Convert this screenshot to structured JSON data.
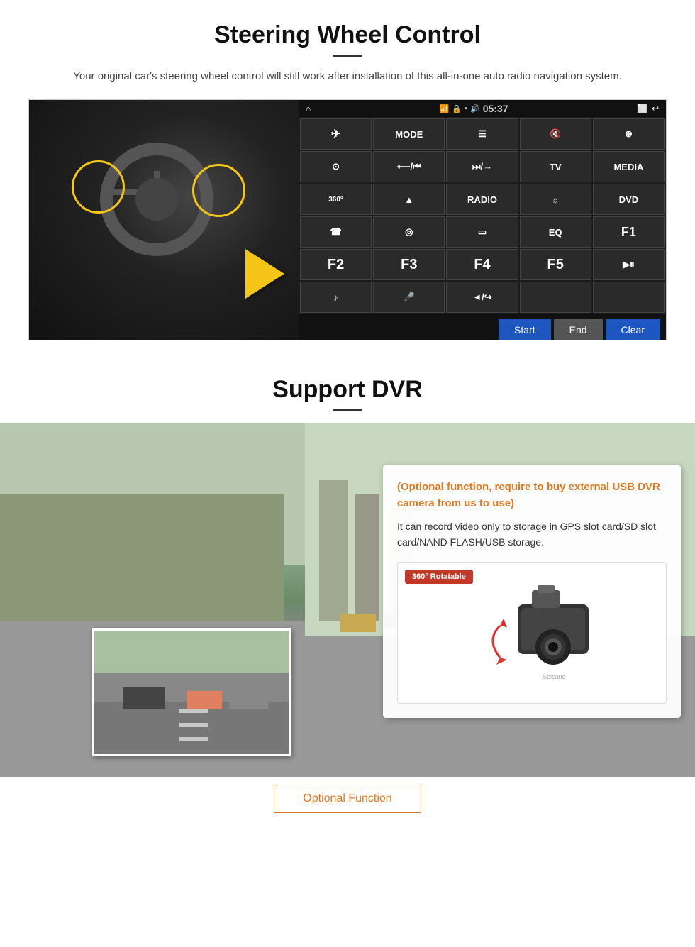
{
  "steering": {
    "title": "Steering Wheel Control",
    "subtitle": "Your original car's steering wheel control will still work after installation of this all-in-one auto radio navigation system.",
    "status_bar": {
      "home_icon": "⌂",
      "wifi_icon": "WiFi",
      "lock_icon": "🔒",
      "battery_icon": "▪",
      "volume_icon": "🔊",
      "time": "05:37",
      "window_icon": "⬜",
      "back_icon": "↩"
    },
    "buttons": [
      {
        "label": "✈",
        "icon": "navigation-icon"
      },
      {
        "label": "MODE",
        "icon": "mode-icon"
      },
      {
        "label": "≡",
        "icon": "menu-icon"
      },
      {
        "label": "🔇",
        "icon": "mute-icon"
      },
      {
        "label": "⊕",
        "icon": "apps-icon"
      },
      {
        "label": "⊙",
        "icon": "settings-icon"
      },
      {
        "label": "⟵/⏮",
        "icon": "rewind-icon"
      },
      {
        "label": "⏭/→",
        "icon": "forward-icon"
      },
      {
        "label": "TV",
        "icon": "tv-icon"
      },
      {
        "label": "MEDIA",
        "icon": "media-icon"
      },
      {
        "label": "360°",
        "icon": "camera360-icon"
      },
      {
        "label": "▲",
        "icon": "eject-icon"
      },
      {
        "label": "RADIO",
        "icon": "radio-icon"
      },
      {
        "label": "☀",
        "icon": "brightness-icon"
      },
      {
        "label": "DVD",
        "icon": "dvd-icon"
      },
      {
        "label": "📞",
        "icon": "phone-icon"
      },
      {
        "label": "◎",
        "icon": "web-icon"
      },
      {
        "label": "▭",
        "icon": "screen-icon"
      },
      {
        "label": "EQ",
        "icon": "eq-icon"
      },
      {
        "label": "F1",
        "icon": "f1-icon"
      },
      {
        "label": "F2",
        "icon": "f2-icon"
      },
      {
        "label": "F3",
        "icon": "f3-icon"
      },
      {
        "label": "F4",
        "icon": "f4-icon"
      },
      {
        "label": "F5",
        "icon": "f5-icon"
      },
      {
        "label": "▶⏸",
        "icon": "playpause-icon"
      },
      {
        "label": "♪",
        "icon": "music-icon"
      },
      {
        "label": "🎤",
        "icon": "mic-icon"
      },
      {
        "label": "◄/↪",
        "icon": "prev-next-icon"
      },
      {
        "label": "",
        "icon": "empty1"
      },
      {
        "label": "",
        "icon": "empty2"
      }
    ],
    "bottom_buttons": {
      "start": "Start",
      "end": "End",
      "clear": "Clear"
    }
  },
  "dvr": {
    "title": "Support DVR",
    "optional_text": "(Optional function, require to buy external USB DVR camera from us to use)",
    "desc_text": "It can record video only to storage in GPS slot card/SD slot card/NAND FLASH/USB storage.",
    "rotatable_badge": "360° Rotatable",
    "optional_function_label": "Optional Function"
  }
}
